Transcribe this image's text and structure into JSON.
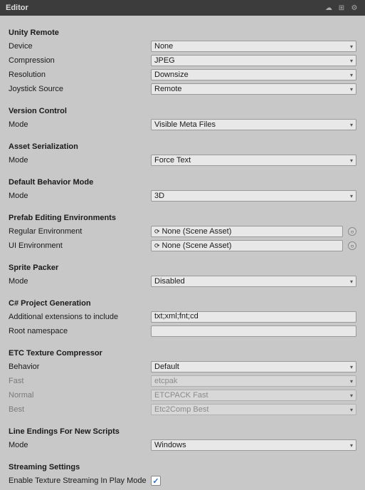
{
  "window": {
    "title": "Editor"
  },
  "sections": {
    "unity_remote": {
      "header": "Unity Remote",
      "fields": [
        {
          "label": "Device",
          "value": "None",
          "type": "select"
        },
        {
          "label": "Compression",
          "value": "JPEG",
          "type": "select"
        },
        {
          "label": "Resolution",
          "value": "Downsize",
          "type": "select"
        },
        {
          "label": "Joystick Source",
          "value": "Remote",
          "type": "select"
        }
      ]
    },
    "version_control": {
      "header": "Version Control",
      "fields": [
        {
          "label": "Mode",
          "value": "Visible Meta Files",
          "type": "select"
        }
      ]
    },
    "asset_serialization": {
      "header": "Asset Serialization",
      "fields": [
        {
          "label": "Mode",
          "value": "Force Text",
          "type": "select"
        }
      ]
    },
    "default_behavior": {
      "header": "Default Behavior Mode",
      "fields": [
        {
          "label": "Mode",
          "value": "3D",
          "type": "select"
        }
      ]
    },
    "prefab_editing": {
      "header": "Prefab Editing Environments",
      "fields": [
        {
          "label": "Regular Environment",
          "value": "None (Scene Asset)",
          "type": "scene"
        },
        {
          "label": "UI Environment",
          "value": "None (Scene Asset)",
          "type": "scene"
        }
      ]
    },
    "sprite_packer": {
      "header": "Sprite Packer",
      "fields": [
        {
          "label": "Mode",
          "value": "Disabled",
          "type": "select"
        }
      ]
    },
    "csharp_generation": {
      "header": "C# Project Generation",
      "fields": [
        {
          "label": "Additional extensions to include",
          "value": "txt;xml;fnt;cd",
          "type": "text"
        },
        {
          "label": "Root namespace",
          "value": "",
          "type": "text"
        }
      ]
    },
    "etc_texture": {
      "header": "ETC Texture Compressor",
      "fields": [
        {
          "label": "Behavior",
          "value": "Default",
          "type": "select",
          "dimmed": false
        },
        {
          "label": "Fast",
          "value": "etcpak",
          "type": "select",
          "dimmed": true
        },
        {
          "label": "Normal",
          "value": "ETCPACK Fast",
          "type": "select",
          "dimmed": true
        },
        {
          "label": "Best",
          "value": "Etc2Comp Best",
          "type": "select",
          "dimmed": true
        }
      ]
    },
    "line_endings": {
      "header": "Line Endings For New Scripts",
      "fields": [
        {
          "label": "Mode",
          "value": "Windows",
          "type": "select"
        }
      ]
    },
    "streaming_settings": {
      "header": "Streaming Settings",
      "fields": [
        {
          "label": "Enable Texture Streaming In Play Mode",
          "value": true,
          "type": "checkbox"
        }
      ]
    }
  },
  "icons": {
    "gear": "⚙",
    "layout": "⊞",
    "cloud": "☁",
    "arrow_down": "▾",
    "checkmark": "✓",
    "scene_icon": "⟳"
  }
}
